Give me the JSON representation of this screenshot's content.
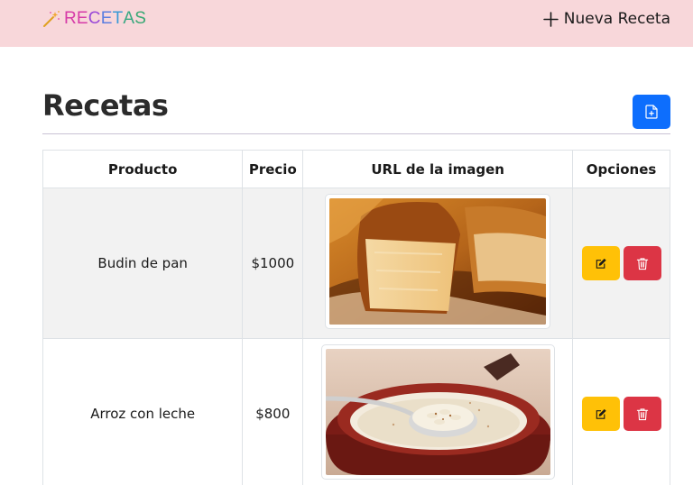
{
  "navbar": {
    "brand_icon": "magic-wand-icon",
    "brand_letters": [
      "R",
      "E",
      "C",
      "E",
      "T",
      "A",
      "S"
    ],
    "brand_colors": [
      "#d63aa8",
      "#d63aa8",
      "#9b4ad8",
      "#5b7de0",
      "#3a9ad6",
      "#38a882",
      "#38a874"
    ],
    "new_recipe_icon": "plus-icon",
    "new_recipe_label": "Nueva Receta"
  },
  "page": {
    "title": "Recetas",
    "add_button_icon": "file-plus-icon",
    "add_button_color": "#0d6efd"
  },
  "table": {
    "headers": [
      "Producto",
      "Precio",
      "URL de la imagen",
      "Opciones"
    ],
    "rows": [
      {
        "product": "Budin de pan",
        "price": "$1000",
        "image": "budin-de-pan-photo"
      },
      {
        "product": "Arroz con leche",
        "price": "$800",
        "image": "arroz-con-leche-photo"
      }
    ],
    "edit_icon": "pencil-square-icon",
    "delete_icon": "trash-icon",
    "edit_color": "#ffc107",
    "delete_color": "#dc3545"
  }
}
